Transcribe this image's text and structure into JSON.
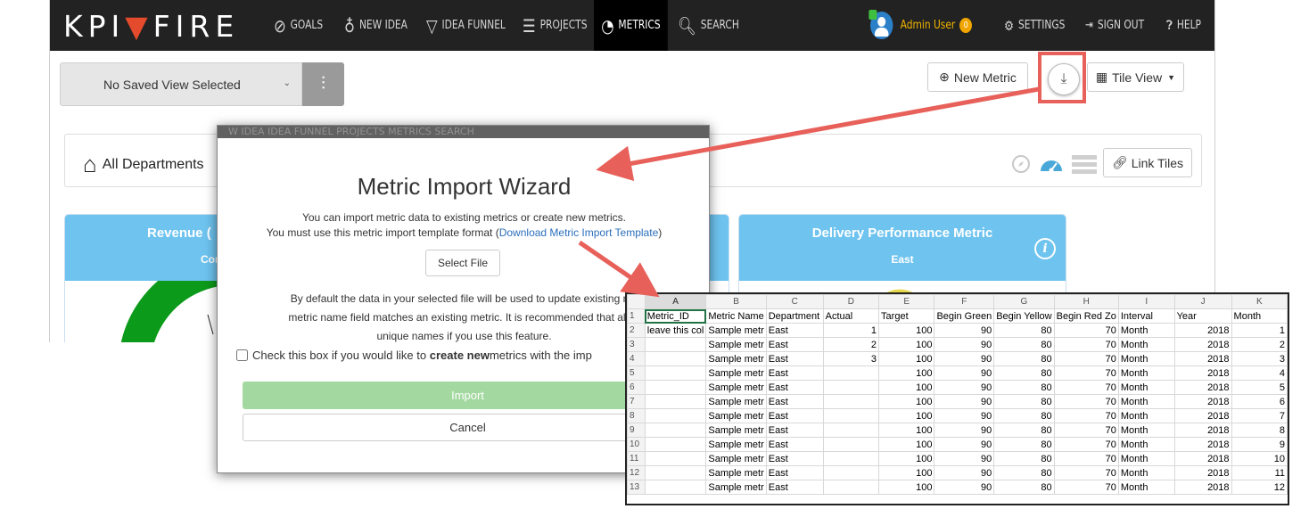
{
  "nav": {
    "logo_left": "KPI",
    "logo_right": "FIRE",
    "items": [
      {
        "label": "GOALS",
        "icon": "compass-icon"
      },
      {
        "label": "NEW IDEA",
        "icon": "lightbulb-icon"
      },
      {
        "label": "IDEA FUNNEL",
        "icon": "funnel-icon"
      },
      {
        "label": "PROJECTS",
        "icon": "projects-icon"
      },
      {
        "label": "METRICS",
        "icon": "gauge-icon"
      },
      {
        "label": "SEARCH",
        "icon": "search-icon"
      }
    ],
    "user": "Admin User",
    "user_badge": "0",
    "settings": "SETTINGS",
    "sign_out": "SIGN OUT",
    "help": "HELP"
  },
  "toolbar": {
    "saved_view": "No Saved View Selected",
    "new_metric": "New Metric",
    "tile_view": "Tile View"
  },
  "department": {
    "title": "All Departments",
    "link_tiles": "Link Tiles"
  },
  "tiles": [
    {
      "title": "Revenue (",
      "sub": "Cor"
    },
    {
      "title": "Delivery Performance Metric",
      "sub": "East"
    }
  ],
  "modal": {
    "ghost_nav": "W IDEA     IDEA FUNNEL      PROJECTS      METRICS      SEARCH",
    "title": "Metric Import Wizard",
    "desc_line1": "You can import metric data to existing metrics or create new metrics.",
    "desc_line2_pre": "You must use this metric import template format (",
    "desc_link": "Download Metric Import Template",
    "desc_line2_post": ")",
    "select_file": "Select File",
    "desc2_line1": "By default the data in your selected file will be used to update existing me",
    "desc2_line2": "metric name field matches an existing metric. It is recommended that all m",
    "desc2_line3": "unique names if you use this feature.",
    "checkbox_pre": "Check this box if you would like to ",
    "checkbox_bold": "create new",
    "checkbox_post": " metrics with the imp",
    "import": "Import",
    "cancel": "Cancel"
  },
  "sheet": {
    "columns": [
      "A",
      "B",
      "C",
      "D",
      "E",
      "F",
      "G",
      "H",
      "I",
      "J",
      "K"
    ],
    "rows": [
      [
        "1",
        "Metric_ID",
        "Metric Name",
        "Department",
        "Actual",
        "Target",
        "Begin Green",
        "Begin Yellow",
        "Begin Red Zo",
        "Interval",
        "Year",
        "Month"
      ],
      [
        "2",
        "leave this col",
        "Sample metr",
        "East",
        "1",
        "100",
        "90",
        "80",
        "70",
        "Month",
        "2018",
        "1"
      ],
      [
        "3",
        "",
        "Sample metr",
        "East",
        "2",
        "100",
        "90",
        "80",
        "70",
        "Month",
        "2018",
        "2"
      ],
      [
        "4",
        "",
        "Sample metr",
        "East",
        "3",
        "100",
        "90",
        "80",
        "70",
        "Month",
        "2018",
        "3"
      ],
      [
        "5",
        "",
        "Sample metr",
        "East",
        "",
        "100",
        "90",
        "80",
        "70",
        "Month",
        "2018",
        "4"
      ],
      [
        "6",
        "",
        "Sample metr",
        "East",
        "",
        "100",
        "90",
        "80",
        "70",
        "Month",
        "2018",
        "5"
      ],
      [
        "7",
        "",
        "Sample metr",
        "East",
        "",
        "100",
        "90",
        "80",
        "70",
        "Month",
        "2018",
        "6"
      ],
      [
        "8",
        "",
        "Sample metr",
        "East",
        "",
        "100",
        "90",
        "80",
        "70",
        "Month",
        "2018",
        "7"
      ],
      [
        "9",
        "",
        "Sample metr",
        "East",
        "",
        "100",
        "90",
        "80",
        "70",
        "Month",
        "2018",
        "8"
      ],
      [
        "10",
        "",
        "Sample metr",
        "East",
        "",
        "100",
        "90",
        "80",
        "70",
        "Month",
        "2018",
        "9"
      ],
      [
        "11",
        "",
        "Sample metr",
        "East",
        "",
        "100",
        "90",
        "80",
        "70",
        "Month",
        "2018",
        "10"
      ],
      [
        "12",
        "",
        "Sample metr",
        "East",
        "",
        "100",
        "90",
        "80",
        "70",
        "Month",
        "2018",
        "11"
      ],
      [
        "13",
        "",
        "Sample metr",
        "East",
        "",
        "100",
        "90",
        "80",
        "70",
        "Month",
        "2018",
        "12"
      ]
    ]
  },
  "colors": {
    "navbar": "#222222",
    "tile_header": "#6ec3ef",
    "annotation": "#e8605a",
    "import_button": "#a3d9a0",
    "admin": "#f0b400"
  }
}
